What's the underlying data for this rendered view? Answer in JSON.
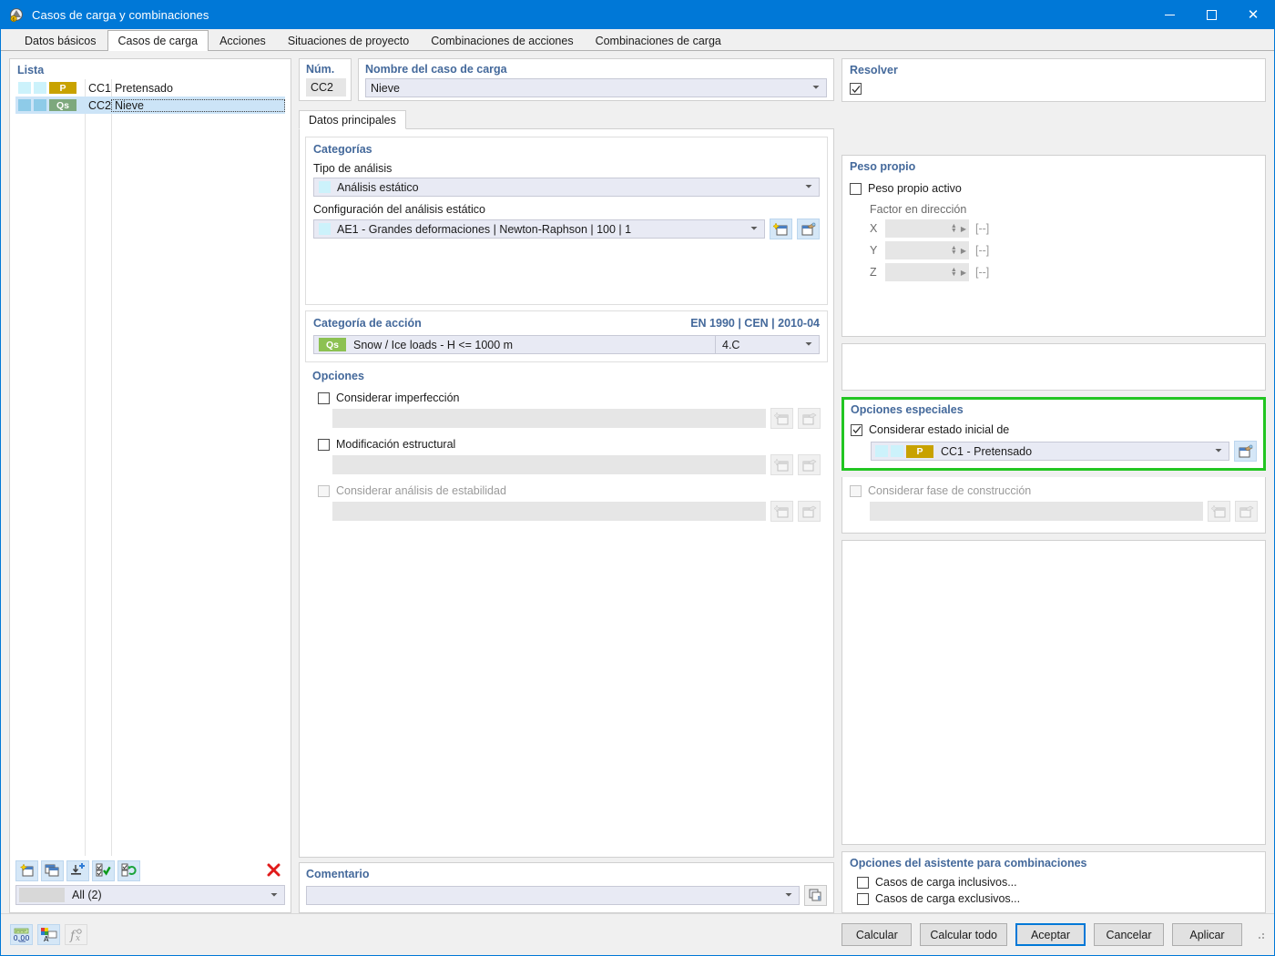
{
  "window": {
    "title": "Casos de carga y combinaciones",
    "icon": "app-icon",
    "minimize_label": "Minimizar",
    "maximize_label": "Maximizar",
    "close_label": "Cerrar"
  },
  "tabs": [
    {
      "label": "Datos básicos",
      "active": false
    },
    {
      "label": "Casos de carga",
      "active": true
    },
    {
      "label": "Acciones",
      "active": false
    },
    {
      "label": "Situaciones de proyecto",
      "active": false
    },
    {
      "label": "Combinaciones de acciones",
      "active": false
    },
    {
      "label": "Combinaciones de carga",
      "active": false
    }
  ],
  "list": {
    "title": "Lista",
    "rows": [
      {
        "badge": "P",
        "badge_color": "#C8A200",
        "sq1": "#ccf2fb",
        "sq2": "#ccf2fb",
        "id": "CC1",
        "name": "Pretensado",
        "selected": false
      },
      {
        "badge": "Qs",
        "badge_color": "#7DA87D",
        "sq1": "#8ecbe8",
        "sq2": "#8ecbe8",
        "id": "CC2",
        "name": "Nieve",
        "selected": true
      }
    ],
    "toolbar": [
      {
        "icon": "new-load-case-icon",
        "label": "Nuevo"
      },
      {
        "icon": "copy-load-case-icon",
        "label": "Copiar"
      },
      {
        "icon": "insert-load-case-icon",
        "label": "Insertar"
      },
      {
        "icon": "select-all-icon",
        "label": "Seleccionar todo"
      },
      {
        "icon": "invert-selection-icon",
        "label": "Invertir selección"
      },
      {
        "icon": "delete-red-x-icon",
        "label": "Eliminar"
      }
    ],
    "filter_value": "All (2)"
  },
  "num": {
    "label": "Núm.",
    "value": "CC2"
  },
  "name": {
    "label": "Nombre del caso de carga",
    "value": "Nieve"
  },
  "inner_tab": {
    "label": "Datos principales"
  },
  "categories": {
    "title": "Categorías",
    "analysis_type_label": "Tipo de análisis",
    "analysis_type_value": "Análisis estático",
    "static_config_label": "Configuración del análisis estático",
    "static_config_value": "AE1 - Grandes deformaciones | Newton-Raphson | 100 | 1",
    "new_icon": "new-item-icon",
    "edit_icon": "edit-item-icon"
  },
  "action_category": {
    "title": "Categoría de acción",
    "standard": "EN 1990 | CEN | 2010-04",
    "badge": "Qs",
    "badge_color": "#8CC152",
    "value": "Snow / Ice loads - H <= 1000 m",
    "code": "4.C"
  },
  "options": {
    "title": "Opciones",
    "items": [
      {
        "label": "Considerar imperfección",
        "checked": false,
        "disabled": false,
        "field_value": ""
      },
      {
        "label": "Modificación estructural",
        "checked": false,
        "disabled": false,
        "field_value": ""
      },
      {
        "label": "Considerar análisis de estabilidad",
        "checked": false,
        "disabled": true,
        "field_value": ""
      }
    ]
  },
  "comment": {
    "title": "Comentario",
    "value": "",
    "copy_icon": "copy-comment-icon"
  },
  "solve": {
    "title": "Resolver",
    "checked": true
  },
  "self_weight": {
    "title": "Peso propio",
    "active_label": "Peso propio activo",
    "active_checked": false,
    "factor_label": "Factor en dirección",
    "axes": [
      {
        "name": "X",
        "value": "",
        "unit": "[--]"
      },
      {
        "name": "Y",
        "value": "",
        "unit": "[--]"
      },
      {
        "name": "Z",
        "value": "",
        "unit": "[--]"
      }
    ]
  },
  "special_options": {
    "title": "Opciones especiales",
    "highlight_color": "#22c522",
    "initial_state_label": "Considerar estado inicial de",
    "initial_state_checked": true,
    "initial_state_badge": "P",
    "initial_state_badge_color": "#C8A200",
    "initial_state_value": "CC1 - Pretensado",
    "edit_icon": "edit-item-icon"
  },
  "construction_stage": {
    "label": "Considerar fase de construcción",
    "checked": false,
    "disabled": true,
    "field_value": ""
  },
  "wizard_options": {
    "title": "Opciones del asistente para combinaciones",
    "items": [
      {
        "label": "Casos de carga inclusivos...",
        "checked": false
      },
      {
        "label": "Casos de carga exclusivos...",
        "checked": false
      }
    ]
  },
  "footer": {
    "tools": [
      {
        "icon": "units-decimal-icon",
        "label": "Unidades y decimales"
      },
      {
        "icon": "display-properties-icon",
        "label": "Propiedades de visualización"
      },
      {
        "icon": "formula-icon",
        "label": "Fórmula"
      }
    ],
    "buttons": [
      {
        "label": "Calcular",
        "default": false
      },
      {
        "label": "Calcular todo",
        "default": false
      },
      {
        "label": "Aceptar",
        "default": true
      },
      {
        "label": "Cancelar",
        "default": false
      },
      {
        "label": "Aplicar",
        "default": false
      }
    ]
  }
}
